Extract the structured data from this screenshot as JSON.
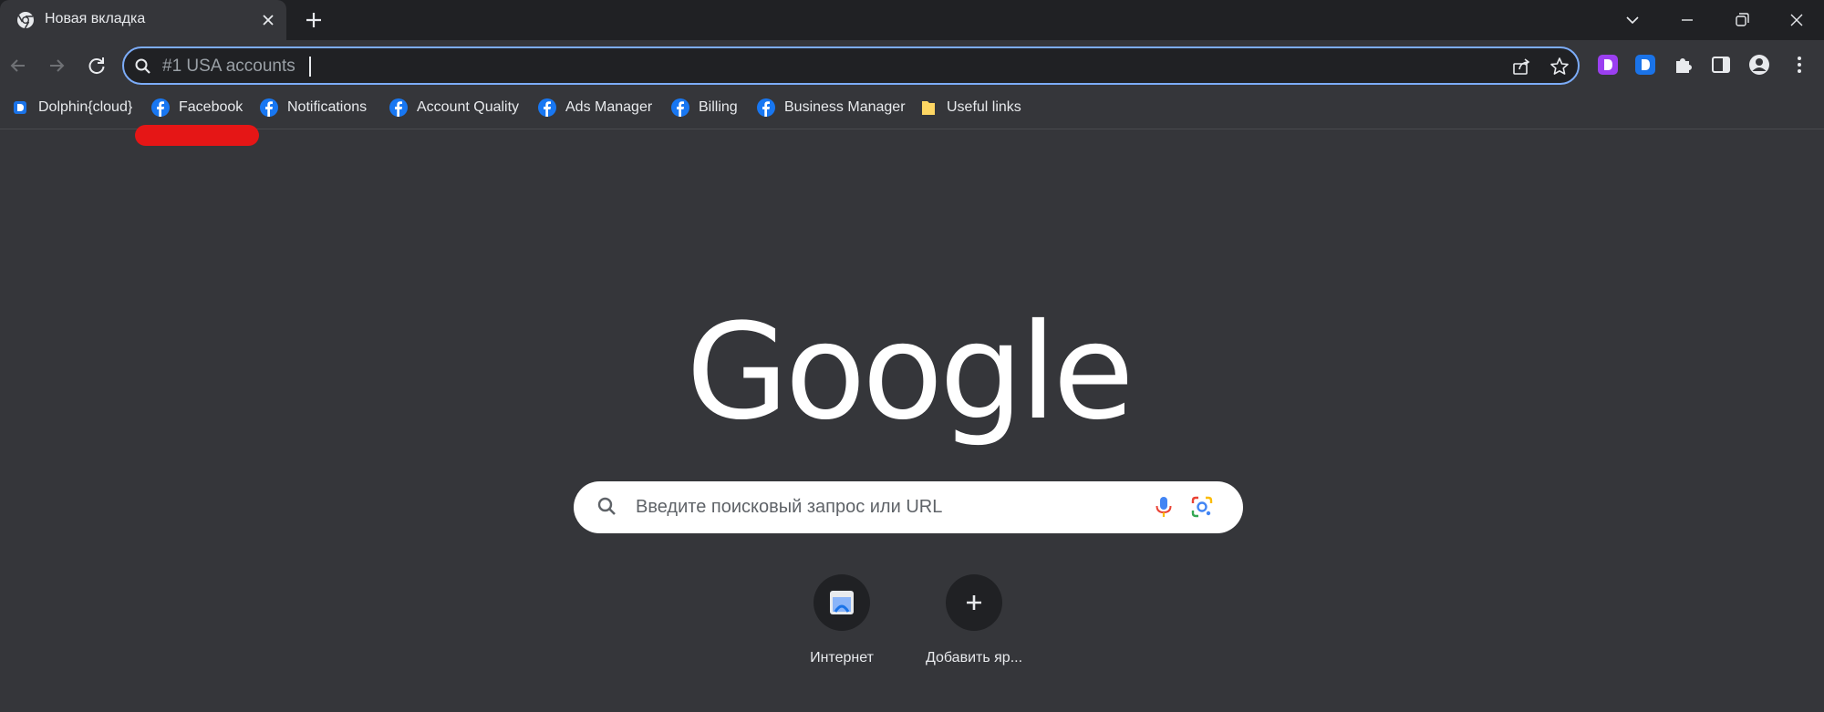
{
  "tab": {
    "title": "Новая вкладка"
  },
  "omnibox": {
    "text": "#1 USA accounts"
  },
  "bookmarks": [
    {
      "label": "Dolphin{cloud}",
      "icon": "dolphin-icon"
    },
    {
      "label": "Facebook",
      "icon": "facebook-icon"
    },
    {
      "label": "Notifications",
      "icon": "facebook-icon"
    },
    {
      "label": "Account Quality",
      "icon": "facebook-icon"
    },
    {
      "label": "Ads Manager",
      "icon": "facebook-icon"
    },
    {
      "label": "Billing",
      "icon": "facebook-icon"
    },
    {
      "label": "Business Manager",
      "icon": "facebook-icon"
    },
    {
      "label": "Useful links",
      "icon": "folder-icon"
    }
  ],
  "ntp": {
    "logo": "Google",
    "search_placeholder": "Введите поисковый запрос или URL",
    "shortcuts": [
      {
        "label": "Интернет",
        "icon": "internet-shortcut-icon"
      },
      {
        "label": "Добавить яр...",
        "icon": "plus-icon"
      }
    ]
  },
  "colors": {
    "frame": "#202124",
    "toolbar": "#35363a",
    "omnibox_focus": "#7cacf8",
    "facebook": "#1877f2",
    "annotation": "#e51616"
  }
}
